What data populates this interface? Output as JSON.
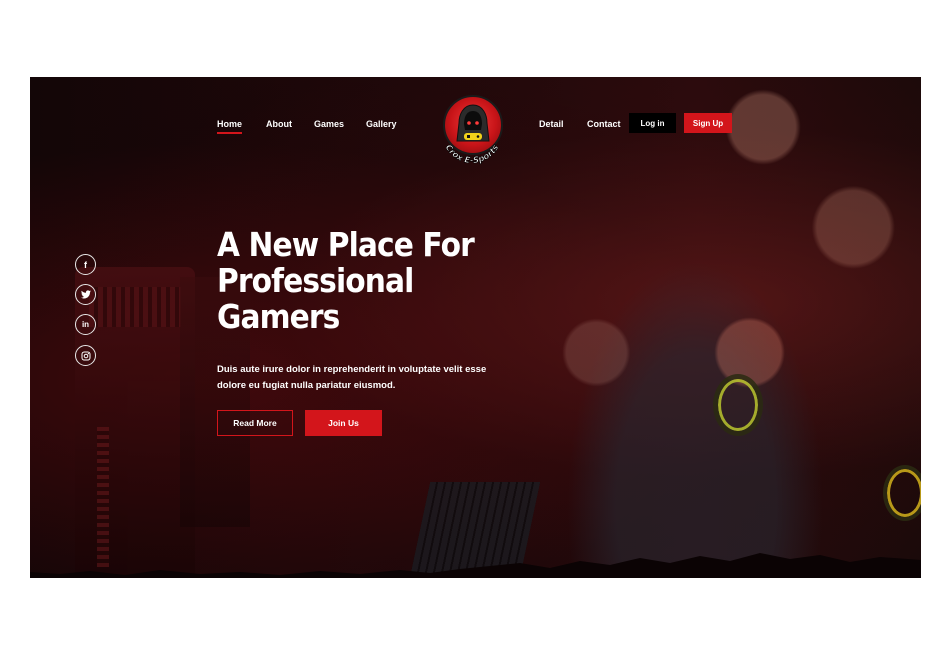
{
  "nav": {
    "left": [
      "Home",
      "About",
      "Games",
      "Gallery"
    ],
    "right": [
      "Detail",
      "Contact"
    ],
    "active": "Home",
    "login_label": "Log in",
    "signup_label": "Sign Up"
  },
  "logo": {
    "brand_text": "Crox E-Sports",
    "icon": "hooded-gamer-logo-icon"
  },
  "social": [
    {
      "icon": "facebook-icon",
      "glyph": "f"
    },
    {
      "icon": "twitter-icon",
      "glyph": "🐦"
    },
    {
      "icon": "linkedin-icon",
      "glyph": "in"
    },
    {
      "icon": "instagram-icon",
      "glyph": "◎"
    }
  ],
  "hero": {
    "headline_lines": [
      "A New Place For",
      "Professional",
      "Gamers"
    ],
    "subtext": "Duis aute irure dolor in reprehenderit in voluptate velit esse dolore eu fugiat nulla pariatur eiusmod.",
    "read_more_label": "Read More",
    "join_label": "Join Us"
  },
  "colors": {
    "accent": "#d3151b",
    "background": "#1a0607",
    "text": "#ffffff"
  }
}
